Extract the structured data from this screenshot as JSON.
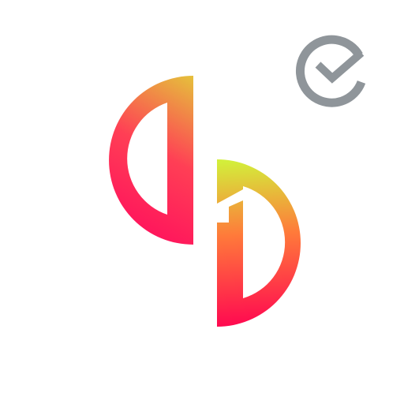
{
  "colors": {
    "background": "#ffffff",
    "gradient_warm_red": "#ff0a5e",
    "gradient_mid_orange": "#ff6a3c",
    "gradient_yellow": "#d6e83a",
    "gradient_pink": "#ff1466",
    "gradient_gold": "#e8c03a",
    "badge_gray": "#8f959a"
  },
  "icons": {
    "logo": "split-half-disc-logo-icon",
    "badge": "check-circle-badge-icon"
  }
}
